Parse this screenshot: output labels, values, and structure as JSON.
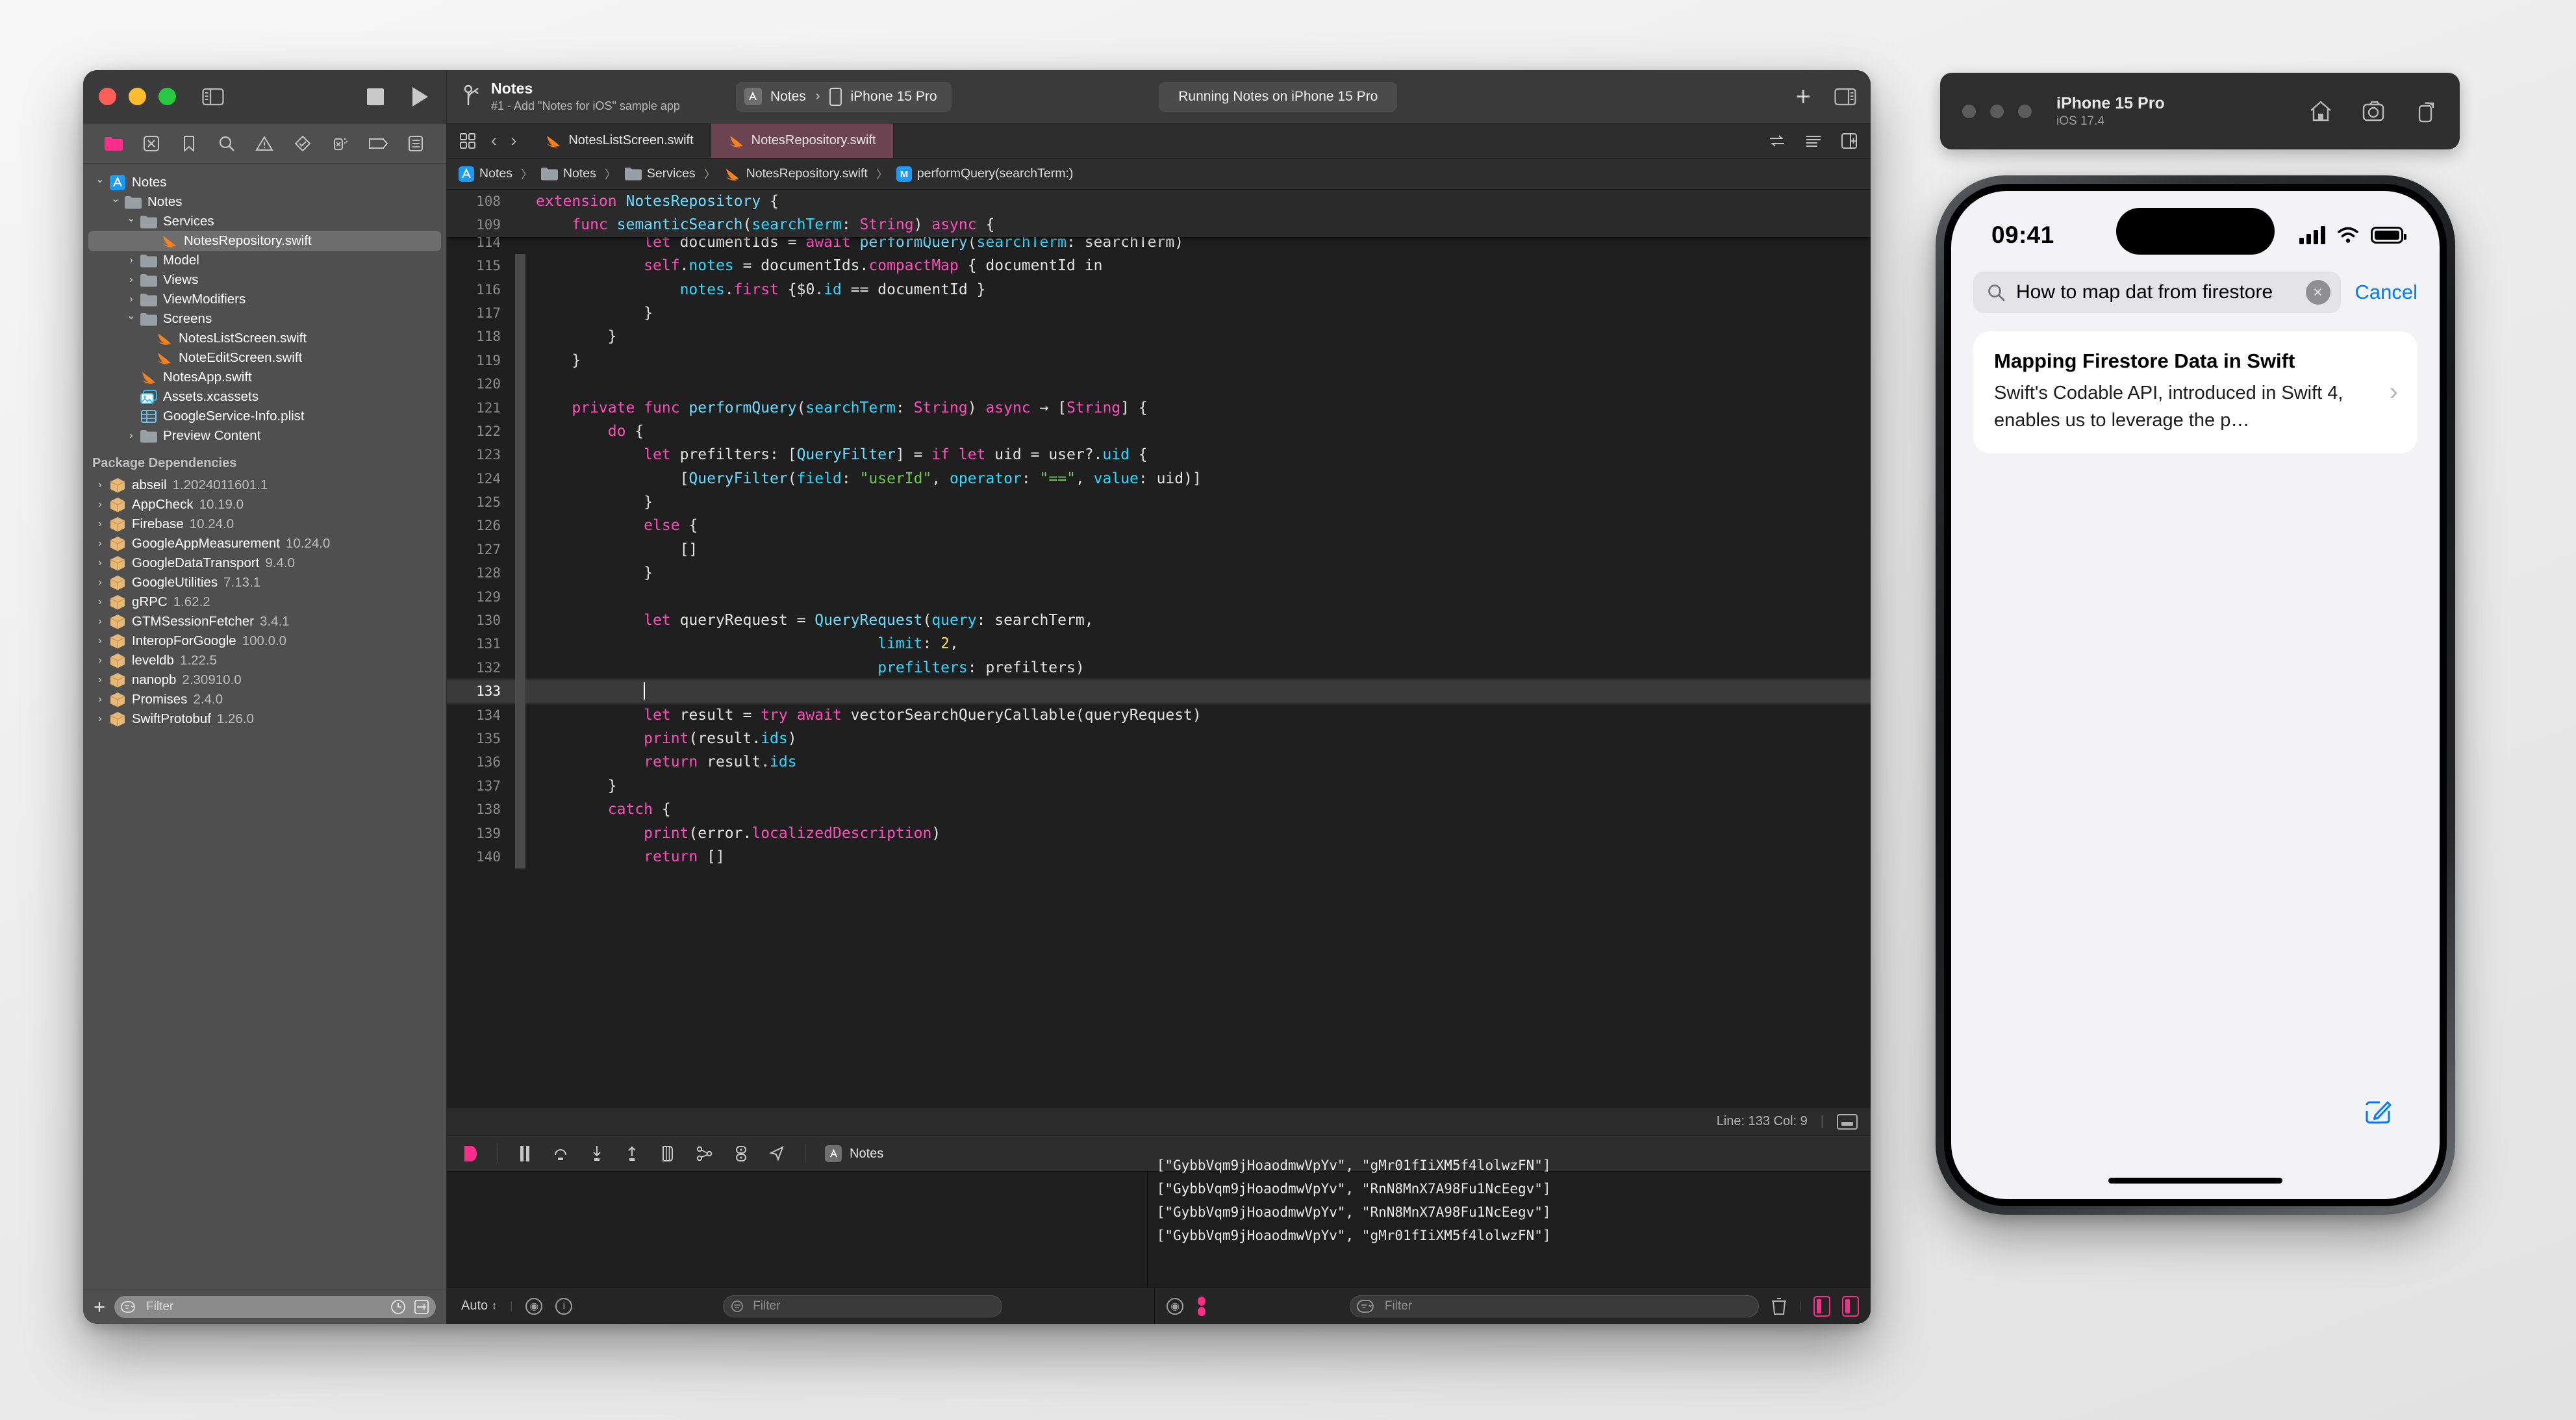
{
  "window": {
    "traffic_lights": [
      "close",
      "minimize",
      "zoom"
    ],
    "project_name": "Notes",
    "project_subtitle": "#1 - Add \"Notes for iOS\" sample app",
    "scheme": "Notes",
    "destination": "iPhone 15 Pro",
    "status": "Running Notes on iPhone 15 Pro",
    "add_button": "+"
  },
  "navigator": {
    "toolbar_icons": [
      "folder-icon",
      "source-control-icon",
      "bookmark-icon",
      "search-icon",
      "issue-icon",
      "test-icon",
      "debug-icon",
      "breakpoint-icon",
      "report-icon"
    ],
    "tree": [
      {
        "label": "Notes",
        "icon": "xcode-project-icon",
        "indent": 0,
        "disclosure": "open",
        "selected": false
      },
      {
        "label": "Notes",
        "icon": "folder-icon",
        "indent": 1,
        "disclosure": "open",
        "selected": false
      },
      {
        "label": "Services",
        "icon": "folder-icon",
        "indent": 2,
        "disclosure": "open",
        "selected": false
      },
      {
        "label": "NotesRepository.swift",
        "icon": "swift-icon",
        "indent": 3,
        "disclosure": "none",
        "selected": true
      },
      {
        "label": "Model",
        "icon": "folder-icon",
        "indent": 2,
        "disclosure": "closed",
        "selected": false
      },
      {
        "label": "Views",
        "icon": "folder-icon",
        "indent": 2,
        "disclosure": "closed",
        "selected": false
      },
      {
        "label": "ViewModifiers",
        "icon": "folder-icon",
        "indent": 2,
        "disclosure": "closed",
        "selected": false
      },
      {
        "label": "Screens",
        "icon": "folder-icon",
        "indent": 2,
        "disclosure": "open",
        "selected": false
      },
      {
        "label": "NotesListScreen.swift",
        "icon": "swift-icon",
        "indent": 3,
        "disclosure": "none",
        "selected": false
      },
      {
        "label": "NoteEditScreen.swift",
        "icon": "swift-icon",
        "indent": 3,
        "disclosure": "none",
        "selected": false
      },
      {
        "label": "NotesApp.swift",
        "icon": "swift-icon",
        "indent": 2,
        "disclosure": "none",
        "selected": false
      },
      {
        "label": "Assets.xcassets",
        "icon": "assets-icon",
        "indent": 2,
        "disclosure": "none",
        "selected": false
      },
      {
        "label": "GoogleService-Info.plist",
        "icon": "plist-icon",
        "indent": 2,
        "disclosure": "none",
        "selected": false
      },
      {
        "label": "Preview Content",
        "icon": "folder-icon",
        "indent": 2,
        "disclosure": "closed",
        "selected": false
      }
    ],
    "section_title": "Package Dependencies",
    "packages": [
      {
        "name": "abseil",
        "version": "1.2024011601.1"
      },
      {
        "name": "AppCheck",
        "version": "10.19.0"
      },
      {
        "name": "Firebase",
        "version": "10.24.0"
      },
      {
        "name": "GoogleAppMeasurement",
        "version": "10.24.0"
      },
      {
        "name": "GoogleDataTransport",
        "version": "9.4.0"
      },
      {
        "name": "GoogleUtilities",
        "version": "7.13.1"
      },
      {
        "name": "gRPC",
        "version": "1.62.2"
      },
      {
        "name": "GTMSessionFetcher",
        "version": "3.4.1"
      },
      {
        "name": "InteropForGoogle",
        "version": "100.0.0"
      },
      {
        "name": "leveldb",
        "version": "1.22.5"
      },
      {
        "name": "nanopb",
        "version": "2.30910.0"
      },
      {
        "name": "Promises",
        "version": "2.4.0"
      },
      {
        "name": "SwiftProtobuf",
        "version": "1.26.0"
      }
    ],
    "filter_placeholder": "Filter",
    "add_label": "+"
  },
  "editor": {
    "tabs": [
      {
        "label": "NotesListScreen.swift",
        "active": false
      },
      {
        "label": "NotesRepository.swift",
        "active": true
      }
    ],
    "breadcrumb": [
      "Notes",
      "Notes",
      "Services",
      "NotesRepository.swift",
      "performQuery(searchTerm:)"
    ],
    "sticky_lines": [
      {
        "no": "108",
        "tokens": [
          [
            "kw",
            "extension "
          ],
          [
            "typ",
            "NotesRepository"
          ],
          [
            "pln",
            " {"
          ]
        ],
        "indent": 0
      },
      {
        "no": "109",
        "tokens": [
          [
            "kw",
            "func "
          ],
          [
            "fn",
            "semanticSearch"
          ],
          [
            "pln",
            "("
          ],
          [
            "prop",
            "searchTerm"
          ],
          [
            "pln",
            ": "
          ],
          [
            "kw",
            "String"
          ],
          [
            "pln",
            ") "
          ],
          [
            "kw",
            "async"
          ],
          [
            "pln",
            " {"
          ]
        ],
        "indent": 1
      }
    ],
    "lines": [
      {
        "no": "114",
        "tokens": [
          [
            "kw",
            "let "
          ],
          [
            "pln",
            "documentIds = "
          ],
          [
            "kw",
            "await "
          ],
          [
            "fn",
            "performQuery"
          ],
          [
            "pln",
            "("
          ],
          [
            "prop",
            "searchTerm"
          ],
          [
            "pln",
            ": searchTerm)"
          ]
        ],
        "indent": 3,
        "partial": true
      },
      {
        "no": "115",
        "tokens": [
          [
            "kw",
            "self"
          ],
          [
            "pln",
            "."
          ],
          [
            "prop",
            "notes"
          ],
          [
            "pln",
            " = documentIds."
          ],
          [
            "mth",
            "compactMap"
          ],
          [
            "pln",
            " { documentId in"
          ]
        ],
        "indent": 3
      },
      {
        "no": "116",
        "tokens": [
          [
            "prop",
            "notes"
          ],
          [
            "pln",
            "."
          ],
          [
            "mth",
            "first"
          ],
          [
            "pln",
            " {$0."
          ],
          [
            "prop",
            "id"
          ],
          [
            "pln",
            " == documentId }"
          ]
        ],
        "indent": 4
      },
      {
        "no": "117",
        "tokens": [
          [
            "pln",
            "}"
          ]
        ],
        "indent": 3
      },
      {
        "no": "118",
        "tokens": [
          [
            "pln",
            "}"
          ]
        ],
        "indent": 2
      },
      {
        "no": "119",
        "tokens": [
          [
            "pln",
            "}"
          ]
        ],
        "indent": 1
      },
      {
        "no": "120",
        "tokens": [
          [
            "pln",
            ""
          ]
        ],
        "indent": 0
      },
      {
        "no": "121",
        "tokens": [
          [
            "kw",
            "private func "
          ],
          [
            "fn",
            "performQuery"
          ],
          [
            "pln",
            "("
          ],
          [
            "prop",
            "searchTerm"
          ],
          [
            "pln",
            ": "
          ],
          [
            "kw",
            "String"
          ],
          [
            "pln",
            ") "
          ],
          [
            "kw",
            "async"
          ],
          [
            "pln",
            " → ["
          ],
          [
            "kw",
            "String"
          ],
          [
            "pln",
            "] {"
          ]
        ],
        "indent": 1
      },
      {
        "no": "122",
        "tokens": [
          [
            "kw",
            "do"
          ],
          [
            "pln",
            " {"
          ]
        ],
        "indent": 2
      },
      {
        "no": "123",
        "tokens": [
          [
            "kw",
            "let "
          ],
          [
            "pln",
            "prefilters: ["
          ],
          [
            "typ",
            "QueryFilter"
          ],
          [
            "pln",
            "] = "
          ],
          [
            "kw",
            "if let "
          ],
          [
            "pln",
            "uid = user?."
          ],
          [
            "prop",
            "uid"
          ],
          [
            "pln",
            " {"
          ]
        ],
        "indent": 3
      },
      {
        "no": "124",
        "tokens": [
          [
            "pln",
            "["
          ],
          [
            "typ",
            "QueryFilter"
          ],
          [
            "pln",
            "("
          ],
          [
            "prop",
            "field"
          ],
          [
            "pln",
            ": "
          ],
          [
            "str",
            "\"userId\""
          ],
          [
            "pln",
            ", "
          ],
          [
            "prop",
            "operator"
          ],
          [
            "pln",
            ": "
          ],
          [
            "str",
            "\"==\""
          ],
          [
            "pln",
            ", "
          ],
          [
            "prop",
            "value"
          ],
          [
            "pln",
            ": uid)]"
          ]
        ],
        "indent": 4
      },
      {
        "no": "125",
        "tokens": [
          [
            "pln",
            "}"
          ]
        ],
        "indent": 3
      },
      {
        "no": "126",
        "tokens": [
          [
            "kw",
            "else"
          ],
          [
            "pln",
            " {"
          ]
        ],
        "indent": 3
      },
      {
        "no": "127",
        "tokens": [
          [
            "pln",
            "[]"
          ]
        ],
        "indent": 4
      },
      {
        "no": "128",
        "tokens": [
          [
            "pln",
            "}"
          ]
        ],
        "indent": 3
      },
      {
        "no": "129",
        "tokens": [
          [
            "pln",
            ""
          ]
        ],
        "indent": 0
      },
      {
        "no": "130",
        "tokens": [
          [
            "kw",
            "let "
          ],
          [
            "pln",
            "queryRequest = "
          ],
          [
            "typ",
            "QueryRequest"
          ],
          [
            "pln",
            "("
          ],
          [
            "prop",
            "query"
          ],
          [
            "pln",
            ": searchTerm,"
          ]
        ],
        "indent": 3
      },
      {
        "no": "131",
        "tokens": [
          [
            "pln",
            "                          "
          ],
          [
            "prop",
            "limit"
          ],
          [
            "pln",
            ": "
          ],
          [
            "num",
            "2"
          ],
          [
            "pln",
            ","
          ]
        ],
        "indent": 3
      },
      {
        "no": "132",
        "tokens": [
          [
            "pln",
            "                          "
          ],
          [
            "prop",
            "prefilters"
          ],
          [
            "pln",
            ": prefilters)"
          ]
        ],
        "indent": 3
      },
      {
        "no": "133",
        "tokens": [],
        "indent": 3,
        "current": true,
        "caret": true
      },
      {
        "no": "134",
        "tokens": [
          [
            "kw",
            "let "
          ],
          [
            "pln",
            "result = "
          ],
          [
            "kw",
            "try await "
          ],
          [
            "pln",
            "vectorSearchQueryCallable(queryRequest)"
          ]
        ],
        "indent": 3
      },
      {
        "no": "135",
        "tokens": [
          [
            "mth",
            "print"
          ],
          [
            "pln",
            "(result."
          ],
          [
            "prop",
            "ids"
          ],
          [
            "pln",
            ")"
          ]
        ],
        "indent": 3
      },
      {
        "no": "136",
        "tokens": [
          [
            "kw",
            "return "
          ],
          [
            "pln",
            "result."
          ],
          [
            "prop",
            "ids"
          ]
        ],
        "indent": 3
      },
      {
        "no": "137",
        "tokens": [
          [
            "pln",
            "}"
          ]
        ],
        "indent": 2
      },
      {
        "no": "138",
        "tokens": [
          [
            "kw",
            "catch"
          ],
          [
            "pln",
            " {"
          ]
        ],
        "indent": 2
      },
      {
        "no": "139",
        "tokens": [
          [
            "mth",
            "print"
          ],
          [
            "pln",
            "(error."
          ],
          [
            "mth",
            "localizedDescription"
          ],
          [
            "pln",
            ")"
          ]
        ],
        "indent": 3
      },
      {
        "no": "140",
        "tokens": [
          [
            "kw",
            "return "
          ],
          [
            "pln",
            "[]"
          ]
        ],
        "indent": 3
      }
    ],
    "status_line": "Line: 133  Col: 9"
  },
  "debug_bar": {
    "target_label": "Notes",
    "icons": [
      "record-icon",
      "pause-icon",
      "step-over-icon",
      "step-into-icon",
      "step-out-icon",
      "stack-icon",
      "hierarchy-icon",
      "memory-icon",
      "location-icon"
    ]
  },
  "console": {
    "lines": [
      "[\"GybbVqm9jHoaodmwVpYv\", \"gMr01fIiXM5f4lolwzFN\"]",
      "[\"GybbVqm9jHoaodmwVpYv\", \"RnN8MnX7A98Fu1NcEegv\"]",
      "[\"GybbVqm9jHoaodmwVpYv\", \"RnN8MnX7A98Fu1NcEegv\"]",
      "[\"GybbVqm9jHoaodmwVpYv\", \"gMr01fIiXM5f4lolwzFN\"]"
    ],
    "auto_label": "Auto",
    "filter_placeholder": "Filter",
    "variables_filter_placeholder": "Filter"
  },
  "simulator": {
    "device_name": "iPhone 15 Pro",
    "os_version": "iOS 17.4",
    "chrome_icons": [
      "home-icon",
      "screenshot-icon",
      "rotate-icon"
    ],
    "screen": {
      "time": "09:41",
      "status_icons": [
        "cellular-icon",
        "wifi-icon",
        "battery-icon"
      ],
      "search_value": "How to map dat from firestore",
      "cancel_label": "Cancel",
      "results": [
        {
          "title": "Mapping Firestore Data in Swift",
          "subtitle": "Swift's Codable API, introduced in Swift 4, enables us to leverage the p…"
        }
      ],
      "compose_icon": "compose-icon"
    }
  },
  "colors": {
    "accent_pink": "#ff2d8a",
    "ios_blue": "#007aff",
    "tab_active": "#6b4351",
    "swift_orange": "#f05138"
  }
}
